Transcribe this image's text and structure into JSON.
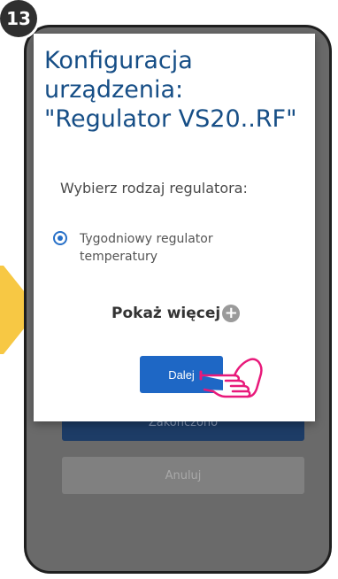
{
  "step": "13",
  "dialog": {
    "title_line1": "Konfiguracja",
    "title_line2": "urządzenia:",
    "title_line3": "\"Regulator VS20..RF\"",
    "prompt": "Wybierz rodzaj regulatora:",
    "option_label": "Tygodniowy regulator temperatury",
    "show_more": "Pokaż więcej",
    "next_button": "Dalej"
  },
  "background": {
    "finish_button": "Zakończono",
    "cancel_button": "Anuluj"
  },
  "colors": {
    "title": "#164e86",
    "primary_button": "#1e67c5",
    "radio": "#2770c8",
    "arrow": "#f7c844",
    "hand": "#e8197a"
  },
  "icons": [
    "plus-icon",
    "pointing-hand-icon",
    "right-arrow-icon"
  ]
}
